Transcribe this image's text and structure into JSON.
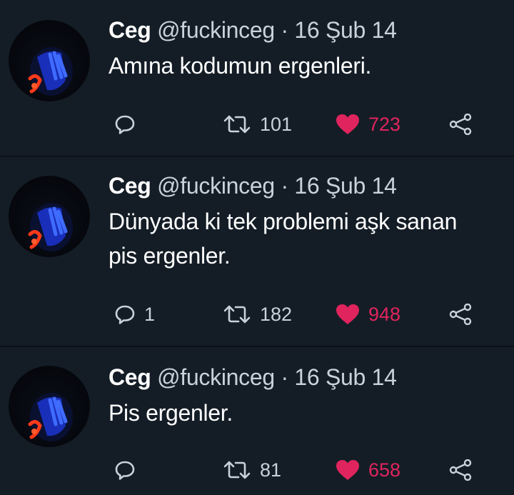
{
  "colors": {
    "background": "#141d26",
    "divider": "#0b1117",
    "text": "#ffffff",
    "secondary": "#c9d2da",
    "like": "#e0245e",
    "avatar_blue": "#2f5bff",
    "avatar_red": "#ff3a1a"
  },
  "tweets": [
    {
      "name": "Ceg",
      "handle": "@fuckinceg",
      "separator": "·",
      "date": "16 Şub 14",
      "text_lines": [
        "Amına kodumun ergenleri."
      ],
      "reply_count": "",
      "retweet_count": "101",
      "like_count": "723",
      "icons": [
        "reply-icon",
        "retweet-icon",
        "heart-icon",
        "share-icon"
      ]
    },
    {
      "name": "Ceg",
      "handle": "@fuckinceg",
      "separator": "·",
      "date": "16 Şub 14",
      "text_lines": [
        "Dünyada ki tek problemi aşk sanan",
        "pis ergenler."
      ],
      "reply_count": "1",
      "retweet_count": "182",
      "like_count": "948",
      "icons": [
        "reply-icon",
        "retweet-icon",
        "heart-icon",
        "share-icon"
      ]
    },
    {
      "name": "Ceg",
      "handle": "@fuckinceg",
      "separator": "·",
      "date": "16 Şub 14",
      "text_lines": [
        "Pis ergenler."
      ],
      "reply_count": "",
      "retweet_count": "81",
      "like_count": "658",
      "icons": [
        "reply-icon",
        "retweet-icon",
        "heart-icon",
        "share-icon"
      ]
    }
  ]
}
